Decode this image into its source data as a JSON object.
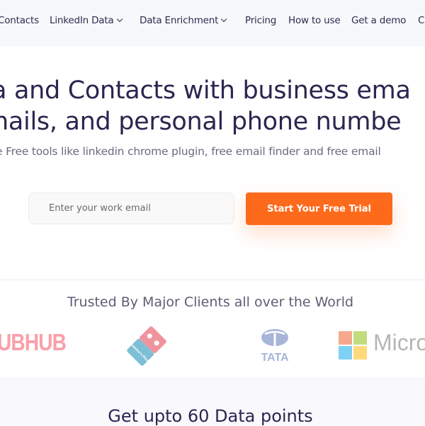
{
  "nav": {
    "items": [
      {
        "label": "Contacts",
        "dropdown": false
      },
      {
        "label": "LinkedIn Data",
        "dropdown": true
      },
      {
        "label": "Data Enrichment",
        "dropdown": true
      },
      {
        "label": "Pricing",
        "dropdown": false
      },
      {
        "label": "How to use",
        "dropdown": false
      },
      {
        "label": "Get a demo",
        "dropdown": false
      },
      {
        "label": "C",
        "dropdown": false
      }
    ]
  },
  "hero": {
    "headline_line1": "a and Contacts with business ema",
    "headline_line2": "nails, and personal phone numbe",
    "subtitle": "e Free tools like linkedin chrome plugin, free email finder and free email",
    "email_placeholder": "Enter your work email",
    "cta_label": "Start Your Free Trial"
  },
  "clients": {
    "title": "Trusted By Major Clients all over the World",
    "logos": [
      "GRUBHUB",
      "Domino's Pizza",
      "TATA",
      "Microsoft"
    ],
    "grubhub_visible": "UBHUB",
    "domino_text": "Domino's Pizza",
    "tata_text": "TATA",
    "microsoft_visible": "Micro"
  },
  "section": {
    "title": "Get upto 60 Data points"
  },
  "colors": {
    "accent": "#fd6a1c",
    "heading": "#2a2650",
    "nav_bg": "#f7f8fa"
  }
}
